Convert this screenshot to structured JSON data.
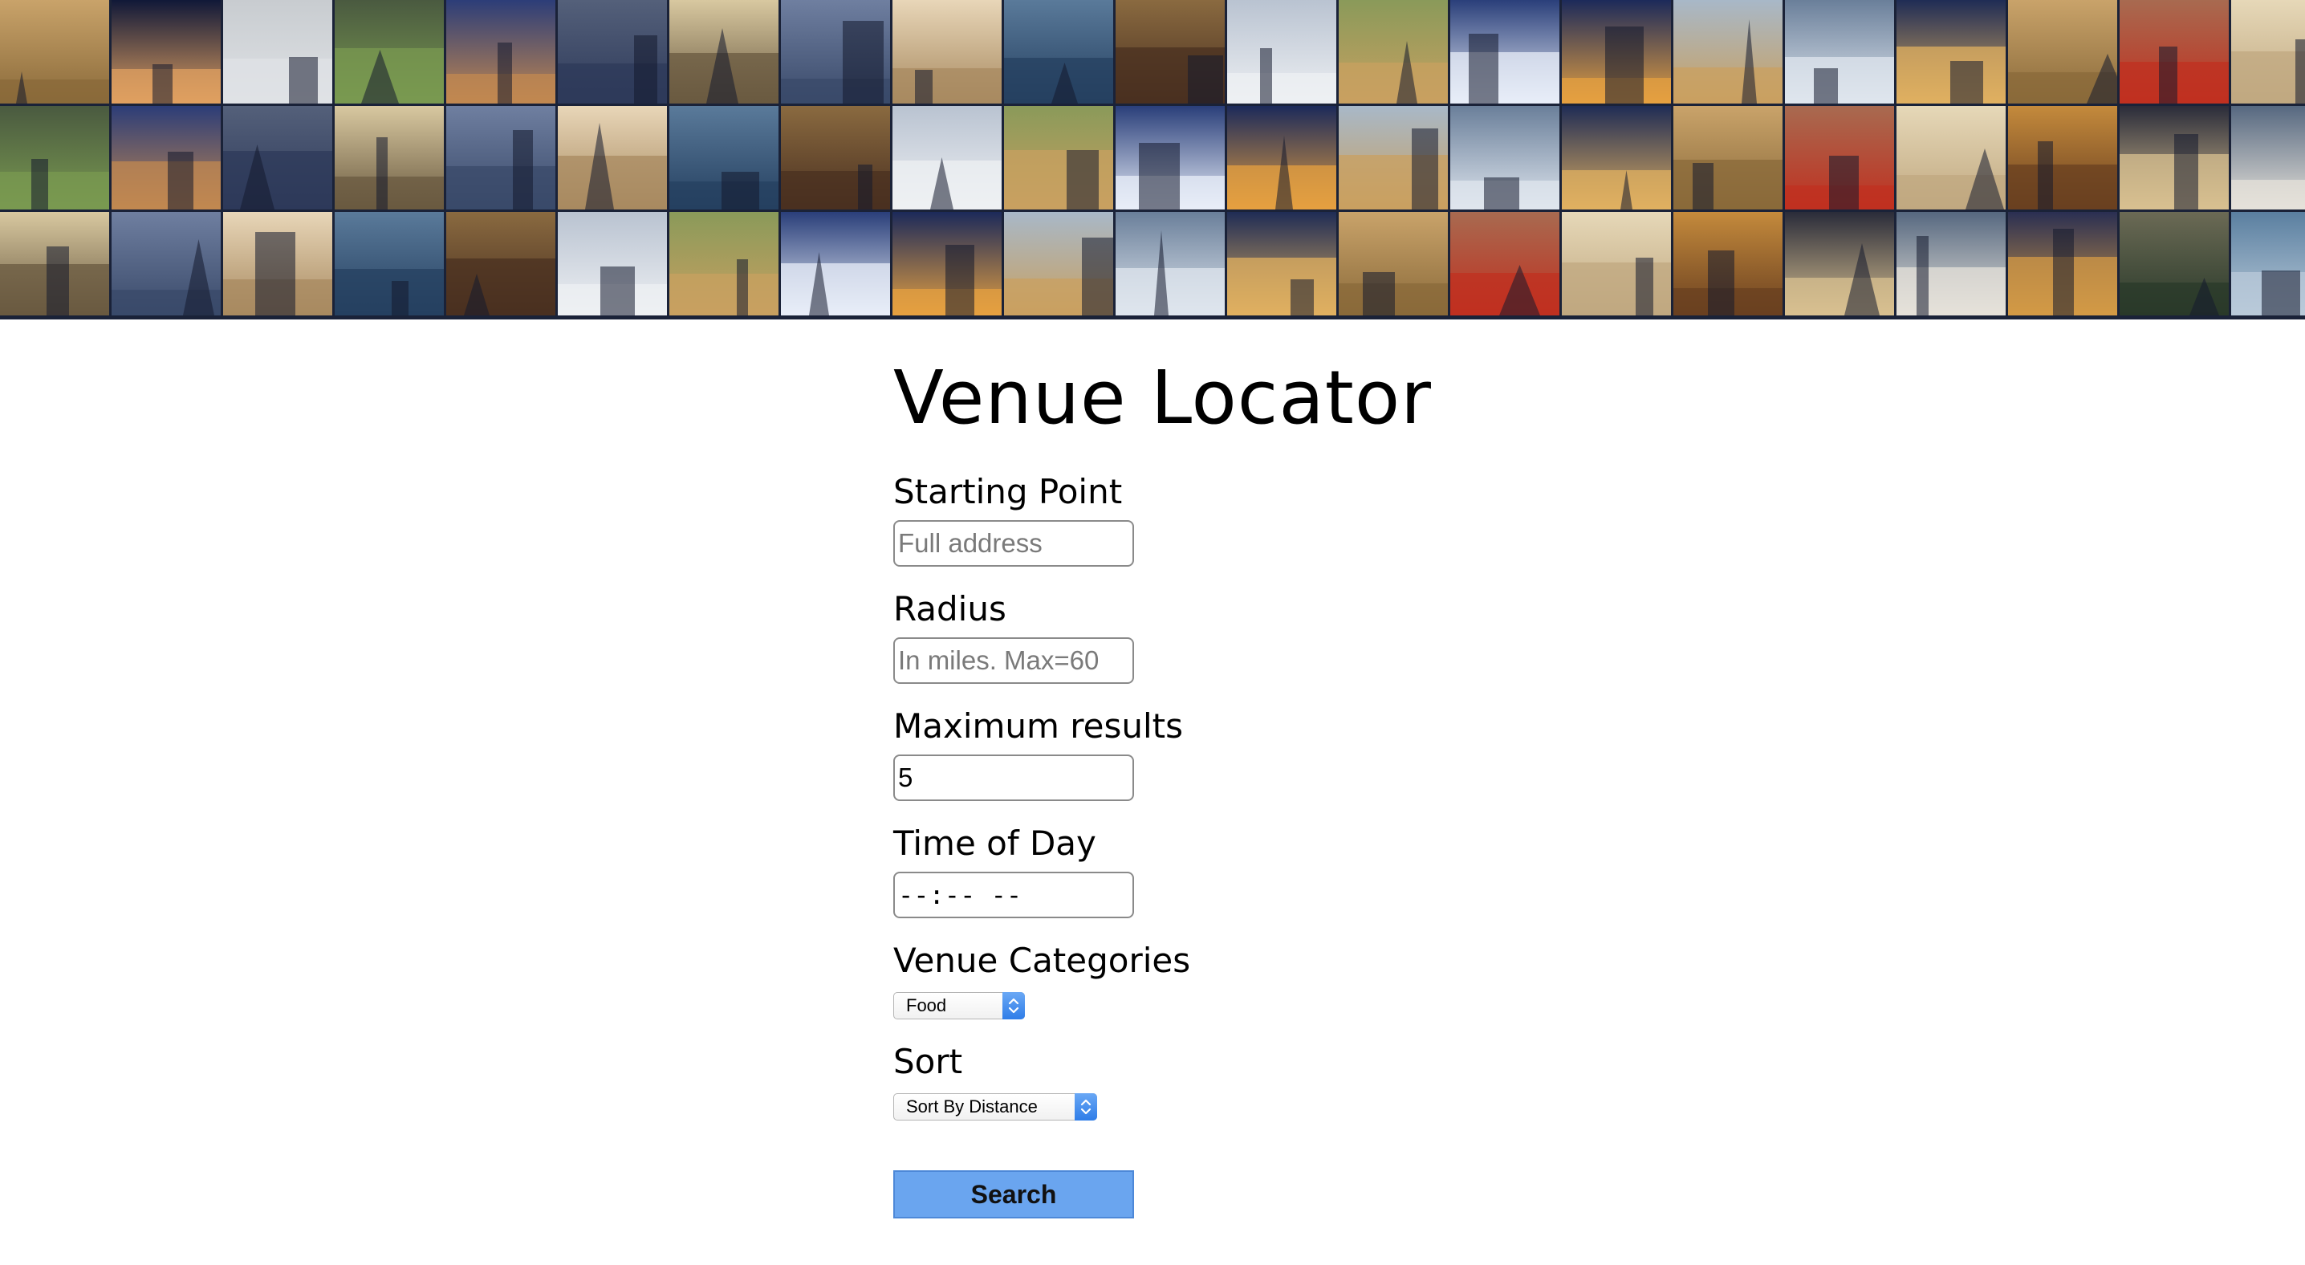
{
  "app": {
    "title": "Venue Locator"
  },
  "banner": {
    "description_icon": "photo-collage"
  },
  "form": {
    "starting_point": {
      "label": "Starting Point",
      "placeholder": "Full address",
      "value": ""
    },
    "radius": {
      "label": "Radius",
      "placeholder": "In miles. Max=60",
      "value": ""
    },
    "max_results": {
      "label": "Maximum results",
      "value": "5"
    },
    "time_of_day": {
      "label": "Time of Day",
      "value": "--:-- --"
    },
    "venue_categories": {
      "label": "Venue Categories",
      "selected": "Food"
    },
    "sort": {
      "label": "Sort",
      "selected": "Sort By Distance"
    },
    "search_label": "Search"
  },
  "colors": {
    "button_bg": "#6aa5ef",
    "select_accent": "#2f7de8"
  }
}
